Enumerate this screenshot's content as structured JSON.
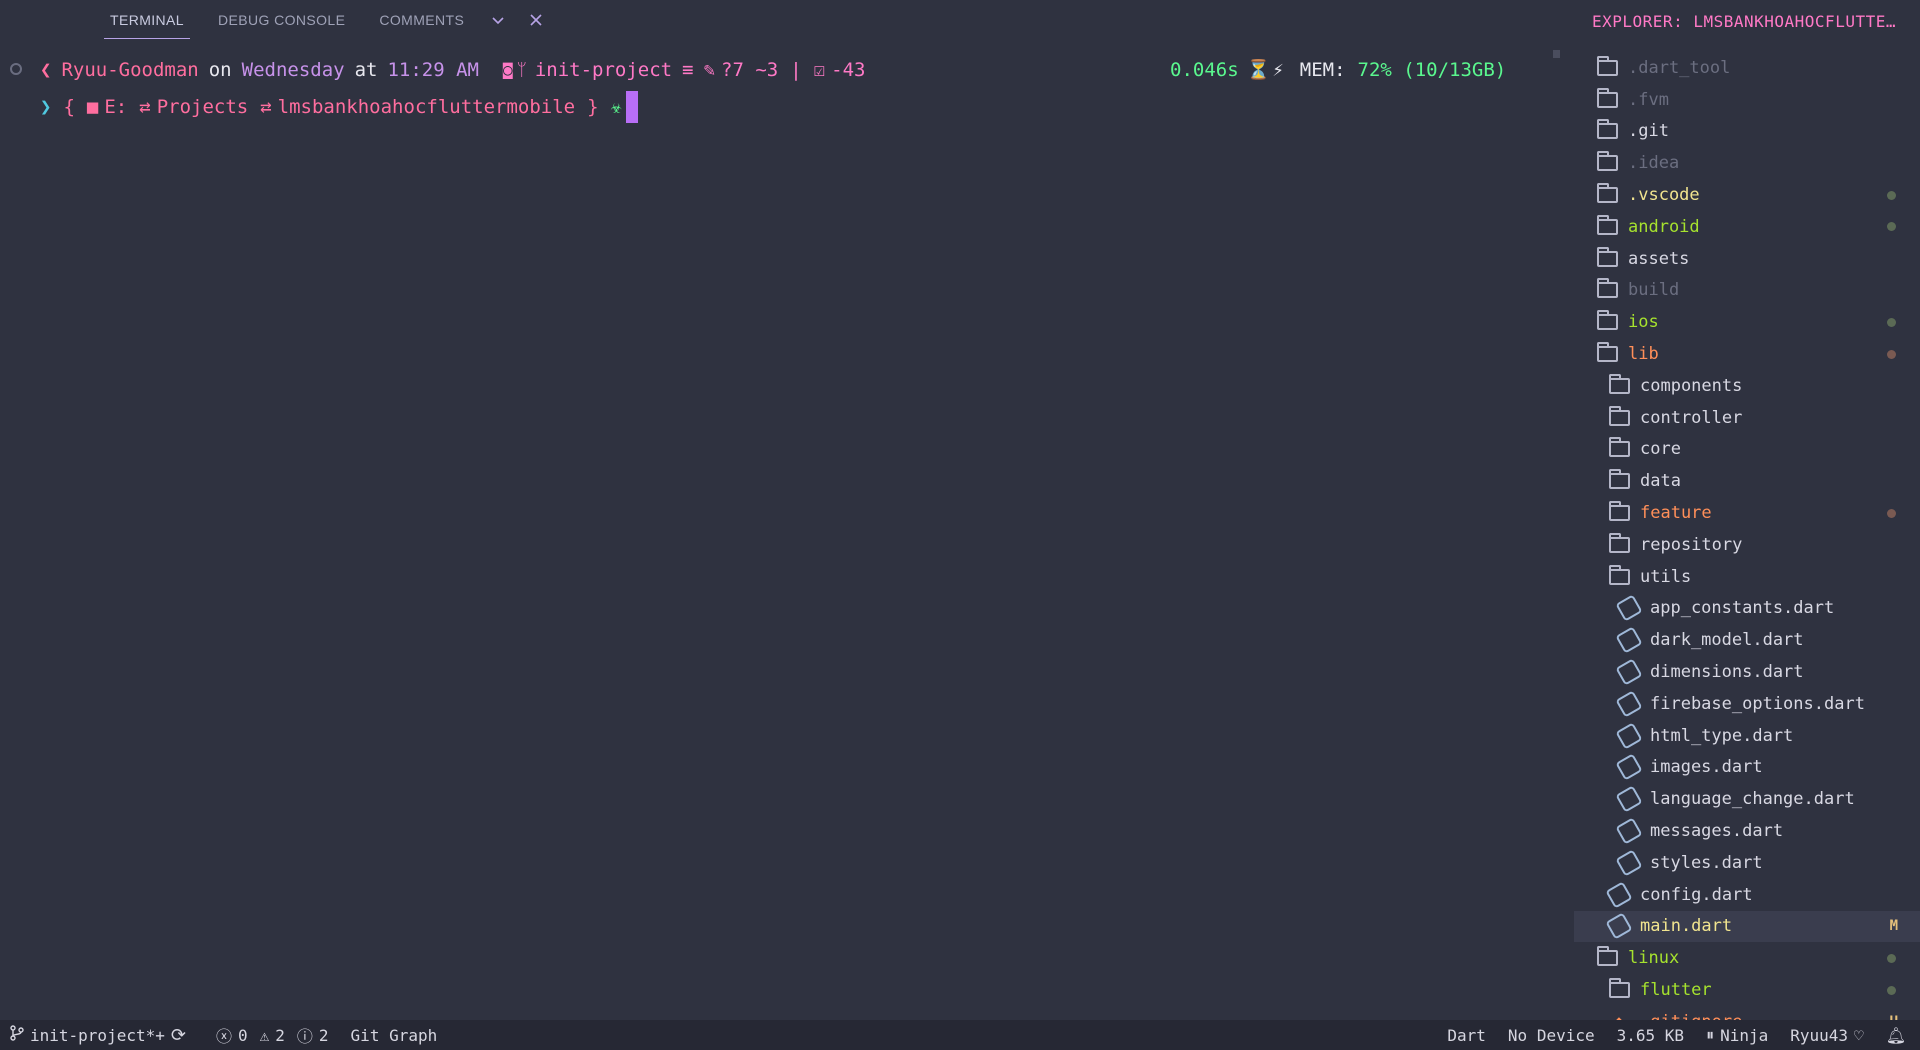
{
  "panel_tabs": [
    {
      "label": "TERMINAL"
    },
    {
      "label": "DEBUG CONSOLE"
    },
    {
      "label": "COMMENTS"
    }
  ],
  "terminal": {
    "prompt": {
      "user": "Ryuu-Goodman",
      "on": "on",
      "day": "Wednesday",
      "at": "at",
      "time": "11:29 AM",
      "branch": "init-project",
      "branch_sep": "≡",
      "changes": "?7 ~3",
      "pipe": "|",
      "tasks": "-43",
      "duration": "0.046s",
      "mem_label": "MEM:",
      "mem_value": "72% (10/13GB)"
    },
    "path": {
      "open": "{",
      "drive": "E:",
      "dir1": "Projects",
      "dir2": "lmsbankhoahocfluttermobile",
      "close": "}"
    }
  },
  "explorer": {
    "title": "EXPLORER: LMSBANKHOAHOCFLUTTE…",
    "items": [
      {
        "label": ".dart_tool",
        "indent": 0,
        "icon": "folder-icon",
        "color": "grey"
      },
      {
        "label": ".fvm",
        "indent": 0,
        "icon": "folder-icon",
        "color": "grey"
      },
      {
        "label": ".git",
        "indent": 0,
        "icon": "git-folder-icon",
        "color": "white"
      },
      {
        "label": ".idea",
        "indent": 0,
        "icon": "idea-folder-icon",
        "color": "grey"
      },
      {
        "label": ".vscode",
        "indent": 0,
        "icon": "vscode-folder-icon",
        "color": "yellow",
        "dot": "green"
      },
      {
        "label": "android",
        "indent": 0,
        "icon": "android-folder-icon",
        "color": "green",
        "dot": "green"
      },
      {
        "label": "assets",
        "indent": 0,
        "icon": "assets-folder-icon",
        "color": "white"
      },
      {
        "label": "build",
        "indent": 0,
        "icon": "build-folder-icon",
        "color": "grey"
      },
      {
        "label": "ios",
        "indent": 0,
        "icon": "folder-icon",
        "color": "green",
        "dot": "green"
      },
      {
        "label": "lib",
        "indent": 0,
        "icon": "folder-open-icon",
        "color": "orange",
        "dot": "orange"
      },
      {
        "label": "components",
        "indent": 1,
        "icon": "components-folder-icon",
        "color": "white"
      },
      {
        "label": "controller",
        "indent": 1,
        "icon": "controller-folder-icon",
        "color": "white"
      },
      {
        "label": "core",
        "indent": 1,
        "icon": "core-folder-icon",
        "color": "white"
      },
      {
        "label": "data",
        "indent": 1,
        "icon": "data-folder-icon",
        "color": "white"
      },
      {
        "label": "feature",
        "indent": 1,
        "icon": "folder-icon",
        "color": "orange",
        "dot": "orange"
      },
      {
        "label": "repository",
        "indent": 1,
        "icon": "folder-icon",
        "color": "white"
      },
      {
        "label": "utils",
        "indent": 1,
        "icon": "utils-folder-icon",
        "color": "white"
      },
      {
        "label": "app_constants.dart",
        "indent": 2,
        "icon": "dart-file-icon",
        "color": "white"
      },
      {
        "label": "dark_model.dart",
        "indent": 2,
        "icon": "dart-file-icon",
        "color": "white"
      },
      {
        "label": "dimensions.dart",
        "indent": 2,
        "icon": "dart-file-icon",
        "color": "white"
      },
      {
        "label": "firebase_options.dart",
        "indent": 2,
        "icon": "dart-file-icon",
        "color": "white"
      },
      {
        "label": "html_type.dart",
        "indent": 2,
        "icon": "dart-file-icon",
        "color": "white"
      },
      {
        "label": "images.dart",
        "indent": 2,
        "icon": "dart-file-icon",
        "color": "white"
      },
      {
        "label": "language_change.dart",
        "indent": 2,
        "icon": "dart-file-icon",
        "color": "white"
      },
      {
        "label": "messages.dart",
        "indent": 2,
        "icon": "dart-file-icon",
        "color": "white"
      },
      {
        "label": "styles.dart",
        "indent": 2,
        "icon": "dart-file-icon",
        "color": "white"
      },
      {
        "label": "config.dart",
        "indent": 1,
        "icon": "dart-file-icon",
        "color": "white"
      },
      {
        "label": "main.dart",
        "indent": 1,
        "icon": "dart-file-icon",
        "color": "yellow",
        "badge": "M",
        "selected": true
      },
      {
        "label": "linux",
        "indent": 0,
        "icon": "folder-icon",
        "color": "green",
        "dot": "green"
      },
      {
        "label": "flutter",
        "indent": 1,
        "icon": "folder-icon",
        "color": "green",
        "dot": "green"
      },
      {
        "label": ".gitignore",
        "indent": 1,
        "icon": "git-file-icon",
        "color": "orange",
        "badge": "U"
      }
    ]
  },
  "status_bar": {
    "branch": "init-project*+",
    "errors": "0",
    "warnings": "2",
    "infos": "2",
    "git_graph": "Git Graph",
    "language": "Dart",
    "device": "No Device",
    "size": "3.65 KB",
    "ninja": "Ninja",
    "user": "Ryuu43"
  }
}
